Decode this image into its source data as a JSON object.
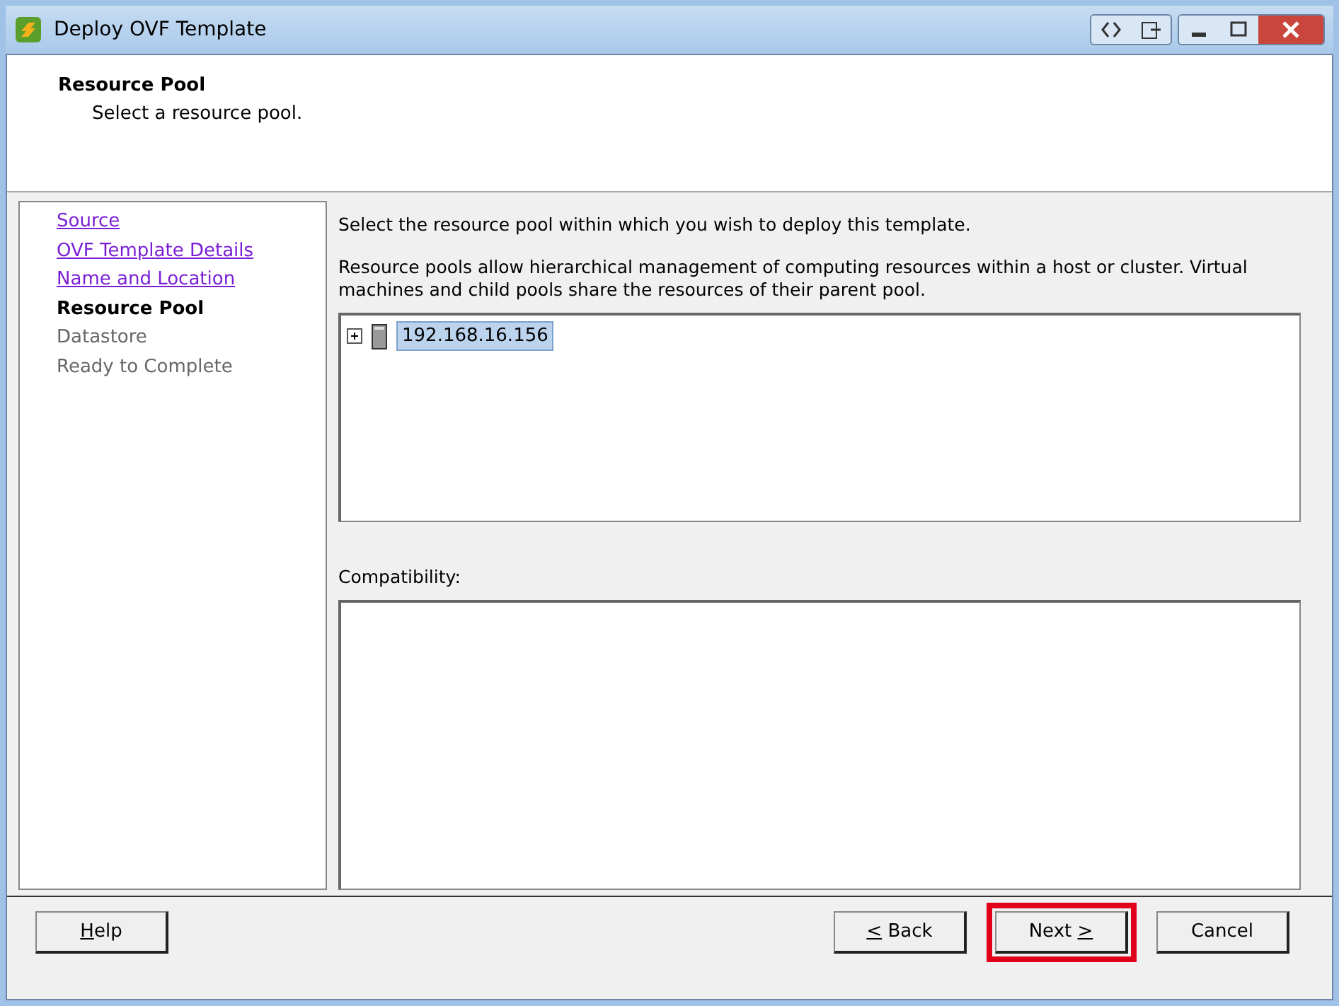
{
  "window": {
    "title": "Deploy OVF Template"
  },
  "header": {
    "title": "Resource Pool",
    "subtitle": "Select a resource pool."
  },
  "steps": [
    {
      "label": "Source",
      "kind": "done"
    },
    {
      "label": "OVF Template Details",
      "kind": "done"
    },
    {
      "label": "Name and Location",
      "kind": "done"
    },
    {
      "label": "Resource Pool",
      "kind": "current"
    },
    {
      "label": "Datastore",
      "kind": "pending"
    },
    {
      "label": "Ready to Complete",
      "kind": "pending"
    }
  ],
  "content": {
    "instruction": "Select the resource pool within which you wish to deploy this template.",
    "description": "Resource pools allow hierarchical management of computing resources within a host or cluster. Virtual machines and child pools share the resources of their parent pool.",
    "tree": [
      {
        "label": "192.168.16.156",
        "expanded": false,
        "selected": true
      }
    ],
    "compatibility_label": "Compatibility:"
  },
  "buttons_left": [
    {
      "access": "H",
      "after": "elp",
      "highlighted": false
    }
  ],
  "buttons_right": [
    {
      "access": "<",
      "after": " Back",
      "highlighted": false
    },
    {
      "before": "Next ",
      "access": ">",
      "highlighted": true
    },
    {
      "before": "Cancel",
      "highlighted": false
    }
  ]
}
